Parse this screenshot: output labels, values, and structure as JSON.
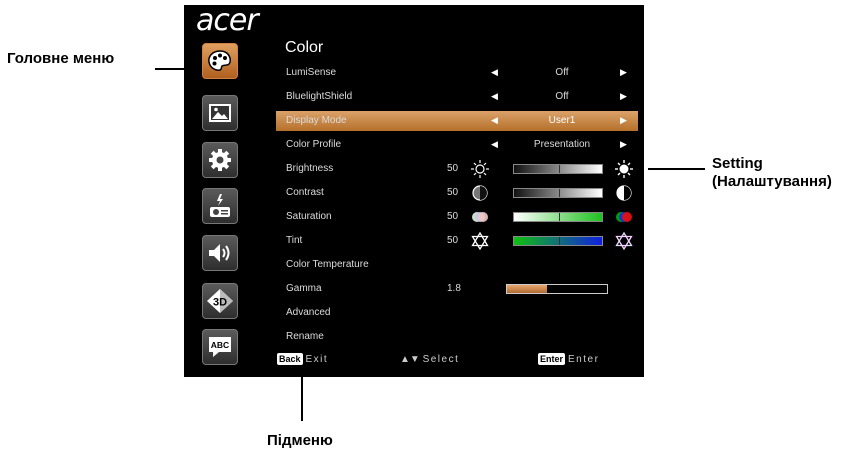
{
  "callouts": {
    "main_menu": "Головне меню",
    "setting_line1": "Setting",
    "setting_line2": "(Налаштування)",
    "submenu": "Підменю"
  },
  "osd": {
    "brand": "acer",
    "menu_title": "Color",
    "sidebar_icons": [
      "palette-icon",
      "image-icon",
      "gear-icon",
      "projector-icon",
      "volume-icon",
      "3d-icon",
      "language-icon"
    ],
    "sidebar_language_label": "ABC",
    "sidebar_3d_label": "3D",
    "rows": [
      {
        "label": "LumiSense",
        "value": "Off"
      },
      {
        "label": "BluelightShield",
        "value": "Off"
      },
      {
        "label": "Display Mode",
        "value": "User1",
        "selected": true
      },
      {
        "label": "Color Profile",
        "value": "Presentation"
      },
      {
        "label": "Brightness",
        "number": "50",
        "level": 0.5
      },
      {
        "label": "Contrast",
        "number": "50",
        "level": 0.5
      },
      {
        "label": "Saturation",
        "number": "50",
        "level": 0.5
      },
      {
        "label": "Tint",
        "number": "50",
        "level": 0.5
      },
      {
        "label": "Color Temperature"
      },
      {
        "label": "Gamma",
        "number": "1.8",
        "level": 0.4
      },
      {
        "label": "Advanced"
      },
      {
        "label": "Rename"
      }
    ],
    "footer": {
      "back_key": "Back",
      "back_text": "Exit",
      "select_text": "Select",
      "enter_key": "Enter",
      "enter_text": "Enter"
    }
  }
}
